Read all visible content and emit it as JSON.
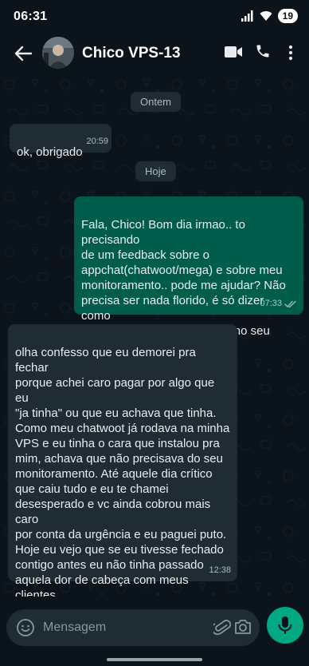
{
  "status_bar": {
    "time": "06:31",
    "battery": "19"
  },
  "header": {
    "contact_name": "Chico VPS-13"
  },
  "chat": {
    "date_dividers": [
      "Ontem",
      "Hoje"
    ],
    "messages": [
      {
        "direction": "incoming",
        "text": "ok, obrigado",
        "time": "20:59"
      },
      {
        "direction": "outgoing",
        "text": "Fala, Chico! Bom dia irmao.. to precisando\nde um feedback sobre o\nappchat(chatwoot/mega) e sobre meu\nmonitoramento.. pode me ajudar? Não\nprecisa ser nada florido, é só dizer como\nera antes e como é agora aí no seu\natendimento..",
        "time": "07:33",
        "status": "read"
      },
      {
        "direction": "incoming",
        "text": "olha confesso que eu demorei pra fechar\nporque achei caro pagar por algo que eu\n\"ja tinha\" ou que eu achava que tinha.\nComo meu chatwoot já rodava na minha\nVPS e eu tinha o cara que instalou pra\nmim, achava que não precisava do seu\nmonitoramento. Até aquele dia crítico\nque caiu tudo e eu te chamei\ndesesperado e vc ainda cobrou mais caro\npor conta da urgência e eu paguei puto.\nHoje eu vejo que se eu tivesse fechado\ncontigo antes eu não tinha passado\naquela dor de cabeça com meus clientes.\nResumo da ópera: vc e sua equipe são\nfoda e eu não largo nunca mais! Uptime\nabsurdo, nada cai, nada trava.",
        "time": "12:38"
      }
    ]
  },
  "composer": {
    "placeholder": "Mensagem"
  },
  "colors": {
    "background": "#0b141a",
    "incoming_bubble": "#1f2c34",
    "outgoing_bubble": "#005c4b",
    "accent": "#00a884"
  },
  "icons": [
    "signal-icon",
    "back-arrow-icon",
    "video-call-icon",
    "phone-icon",
    "more-options-icon",
    "read-receipt-icon",
    "emoji-icon",
    "attach-icon",
    "camera-icon",
    "mic-icon"
  ]
}
